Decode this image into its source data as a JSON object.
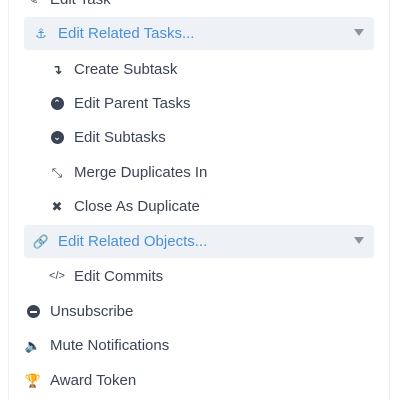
{
  "menu": {
    "top_item": {
      "label": "Edit Task",
      "icon": "pencil-icon"
    },
    "related_tasks": {
      "label": "Edit Related Tasks...",
      "icon": "anchor-icon",
      "items": [
        {
          "label": "Create Subtask",
          "icon": "level-down-icon"
        },
        {
          "label": "Edit Parent Tasks",
          "icon": "chevron-circle-up-icon"
        },
        {
          "label": "Edit Subtasks",
          "icon": "chevron-circle-down-icon"
        },
        {
          "label": "Merge Duplicates In",
          "icon": "compress-icon"
        },
        {
          "label": "Close As Duplicate",
          "icon": "times-icon"
        }
      ]
    },
    "related_objects": {
      "label": "Edit Related Objects...",
      "icon": "link-icon",
      "items": [
        {
          "label": "Edit Commits",
          "icon": "code-icon"
        }
      ]
    },
    "actions": [
      {
        "label": "Unsubscribe",
        "icon": "minus-circle-icon"
      },
      {
        "label": "Mute Notifications",
        "icon": "volume-icon"
      },
      {
        "label": "Award Token",
        "icon": "trophy-icon"
      }
    ]
  },
  "colors": {
    "accent": "#4b8fd6",
    "group_bg": "#eef2f7",
    "text": "#3b4454",
    "caret": "#8a93a3"
  }
}
